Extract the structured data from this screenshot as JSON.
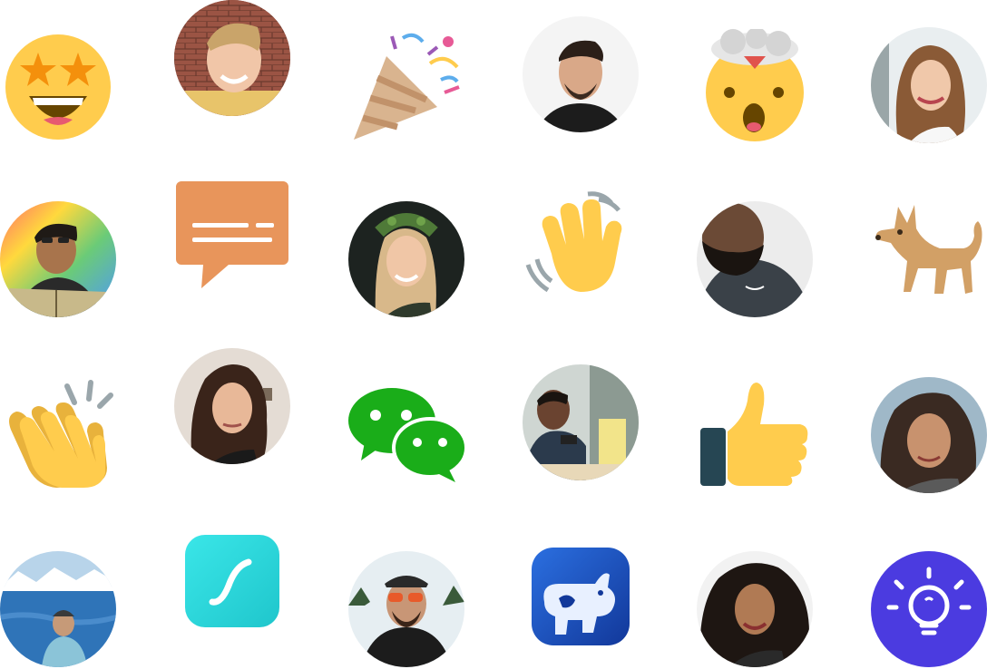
{
  "colors": {
    "emoji_yellow": "#FFCC4D",
    "bubble_orange": "#E8955B",
    "wechat_green": "#1AAD19",
    "thumb_dark": "#264653",
    "lightbulb_purple": "#4B3BE0",
    "app_teal": "#2EE0E0",
    "app_blue": "#1E4AB8"
  },
  "tiles": [
    {
      "kind": "emoji",
      "icon": "star-struck-emoji-icon"
    },
    {
      "kind": "avatar",
      "icon": "avatar-photo-young-man-smiling"
    },
    {
      "kind": "emoji",
      "icon": "party-popper-icon"
    },
    {
      "kind": "avatar",
      "icon": "avatar-photo-man-dark-hoodie"
    },
    {
      "kind": "emoji",
      "icon": "exploding-head-emoji-icon"
    },
    {
      "kind": "avatar",
      "icon": "avatar-photo-woman-long-hair"
    },
    {
      "kind": "avatar",
      "icon": "avatar-photo-man-with-book"
    },
    {
      "kind": "icon",
      "icon": "chat-bubble-icon"
    },
    {
      "kind": "avatar",
      "icon": "avatar-photo-woman-flower-crown"
    },
    {
      "kind": "emoji",
      "icon": "waving-hand-emoji-icon"
    },
    {
      "kind": "avatar",
      "icon": "avatar-photo-bearded-man"
    },
    {
      "kind": "emoji",
      "icon": "dog-emoji-icon"
    },
    {
      "kind": "emoji",
      "icon": "clapping-hands-emoji-icon"
    },
    {
      "kind": "avatar",
      "icon": "avatar-photo-woman-dark-hair"
    },
    {
      "kind": "icon",
      "icon": "wechat-logo-icon"
    },
    {
      "kind": "avatar",
      "icon": "avatar-photo-man-with-phone"
    },
    {
      "kind": "emoji",
      "icon": "thumbs-up-emoji-icon"
    },
    {
      "kind": "avatar",
      "icon": "avatar-photo-woman-curly-hair"
    },
    {
      "kind": "avatar",
      "icon": "avatar-photo-man-by-lake"
    },
    {
      "kind": "icon",
      "icon": "curve-app-icon"
    },
    {
      "kind": "avatar",
      "icon": "avatar-photo-man-sunglasses-snow"
    },
    {
      "kind": "icon",
      "icon": "cow-app-icon"
    },
    {
      "kind": "avatar",
      "icon": "avatar-photo-woman-curly-hair-smiling"
    },
    {
      "kind": "icon",
      "icon": "lightbulb-icon"
    }
  ]
}
